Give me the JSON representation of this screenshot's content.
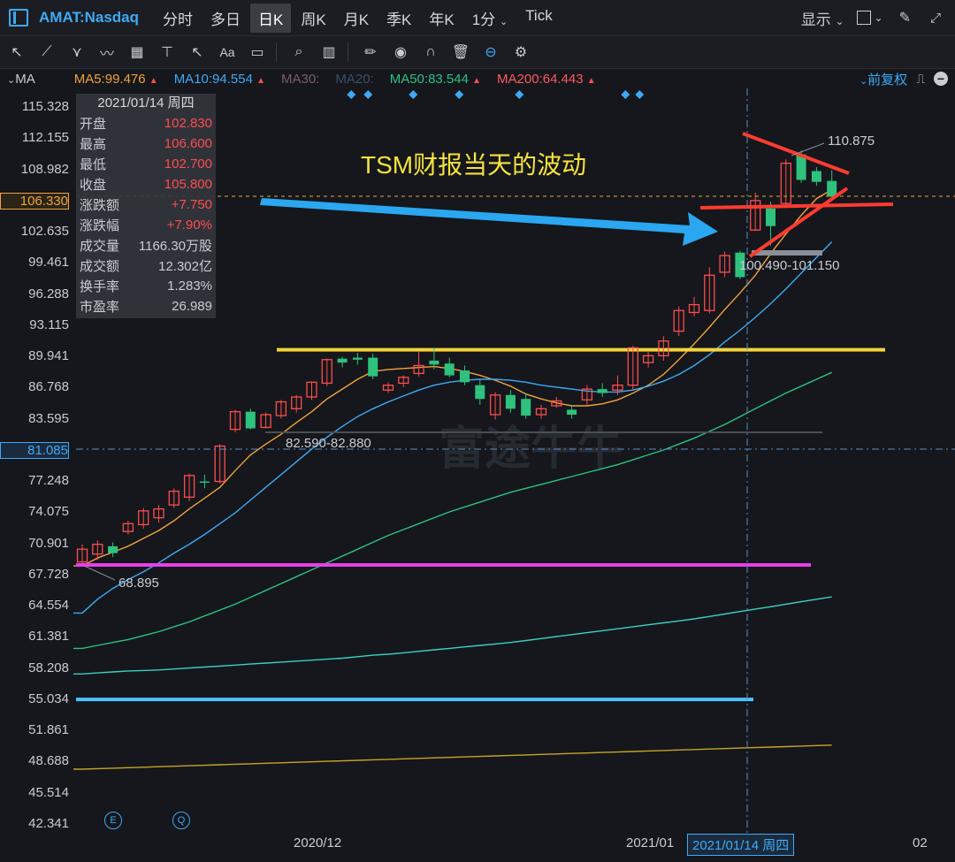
{
  "header": {
    "symbol": "AMAT:Nasdaq",
    "tabs": [
      "分时",
      "多日",
      "日K",
      "周K",
      "月K",
      "季K",
      "年K",
      "1分",
      "Tick"
    ],
    "active_tab": "日K",
    "display_label": "显示"
  },
  "ma_bar": {
    "ma_label": "MA",
    "items": [
      {
        "text": "MA5:99.476",
        "color": "#f0a23c",
        "arrow": "▲"
      },
      {
        "text": "MA10:94.554",
        "color": "#3fa9f5",
        "arrow": "▲"
      },
      {
        "text": "MA30:",
        "color": "#7a5d6e",
        "arrow": ""
      },
      {
        "text": "MA20:",
        "color": "#3b4f6b",
        "arrow": ""
      },
      {
        "text": "MA50:83.544",
        "color": "#2ec27e",
        "arrow": "▲"
      },
      {
        "text": "MA200:64.443",
        "color": "#ff5a5a",
        "arrow": "▲"
      }
    ],
    "adjust_label": "前复权"
  },
  "y_axis": {
    "ticks": [
      "115.328",
      "112.155",
      "108.982",
      "106.330",
      "102.635",
      "99.461",
      "96.288",
      "93.115",
      "89.941",
      "86.768",
      "83.595",
      "81.085",
      "77.248",
      "74.075",
      "70.901",
      "67.728",
      "64.554",
      "61.381",
      "58.208",
      "55.034",
      "51.861",
      "48.688",
      "45.514",
      "42.341"
    ],
    "highlight_price": "106.330",
    "highlight_crosshair": "81.085"
  },
  "info_panel": {
    "date": "2021/01/14 周四",
    "rows": [
      {
        "label": "开盘",
        "value": "102.830",
        "color": "#ff4d4d"
      },
      {
        "label": "最高",
        "value": "106.600",
        "color": "#ff4d4d"
      },
      {
        "label": "最低",
        "value": "102.700",
        "color": "#ff4d4d"
      },
      {
        "label": "收盘",
        "value": "105.800",
        "color": "#ff4d4d"
      },
      {
        "label": "涨跌额",
        "value": "+7.750",
        "color": "#ff4d4d"
      },
      {
        "label": "涨跌幅",
        "value": "+7.90%",
        "color": "#ff4d4d"
      },
      {
        "label": "成交量",
        "value": "1166.30万股",
        "color": "#c9ccd3"
      },
      {
        "label": "成交额",
        "value": "12.302亿",
        "color": "#c9ccd3"
      },
      {
        "label": "换手率",
        "value": "1.283%",
        "color": "#c9ccd3"
      },
      {
        "label": "市盈率",
        "value": "26.989",
        "color": "#c9ccd3"
      }
    ]
  },
  "annotations": {
    "headline": "TSM财报当天的波动",
    "high_label": "110.875",
    "gap_top": "100.490-101.150",
    "gap_mid": "82.590-82.880",
    "low_label": "68.895"
  },
  "x_axis": {
    "labels": [
      "2020/12",
      "2021/01",
      "02"
    ],
    "crosshair_date": "2021/01/14 周四"
  },
  "watermark": "富途牛牛",
  "colors": {
    "up": "#ff4d4d",
    "down": "#2ec27e",
    "accent": "#3fa9f5",
    "background": "#15171c"
  },
  "chart_data": {
    "type": "candlestick",
    "y_range": [
      42.341,
      115.328
    ],
    "candles": [
      {
        "o": 69.0,
        "h": 70.8,
        "l": 68.9,
        "c": 70.3
      },
      {
        "o": 69.8,
        "h": 71.2,
        "l": 69.2,
        "c": 70.8
      },
      {
        "o": 70.6,
        "h": 71.0,
        "l": 69.5,
        "c": 69.9
      },
      {
        "o": 72.1,
        "h": 73.2,
        "l": 71.8,
        "c": 72.9
      },
      {
        "o": 72.8,
        "h": 74.5,
        "l": 72.4,
        "c": 74.2
      },
      {
        "o": 73.5,
        "h": 74.8,
        "l": 73.0,
        "c": 74.4
      },
      {
        "o": 74.8,
        "h": 76.5,
        "l": 74.5,
        "c": 76.2
      },
      {
        "o": 75.6,
        "h": 78.0,
        "l": 75.2,
        "c": 77.8
      },
      {
        "o": 77.2,
        "h": 77.9,
        "l": 76.5,
        "c": 77.1
      },
      {
        "o": 77.2,
        "h": 81.0,
        "l": 77.0,
        "c": 80.8
      },
      {
        "o": 82.5,
        "h": 84.5,
        "l": 82.2,
        "c": 84.3
      },
      {
        "o": 84.3,
        "h": 84.6,
        "l": 82.5,
        "c": 82.6
      },
      {
        "o": 82.7,
        "h": 84.2,
        "l": 82.6,
        "c": 84.0
      },
      {
        "o": 83.9,
        "h": 85.5,
        "l": 83.6,
        "c": 85.3
      },
      {
        "o": 84.6,
        "h": 86.0,
        "l": 84.2,
        "c": 85.8
      },
      {
        "o": 85.8,
        "h": 87.4,
        "l": 85.5,
        "c": 87.3
      },
      {
        "o": 87.2,
        "h": 89.7,
        "l": 86.9,
        "c": 89.6
      },
      {
        "o": 89.7,
        "h": 89.9,
        "l": 88.8,
        "c": 89.3
      },
      {
        "o": 89.8,
        "h": 90.3,
        "l": 89.1,
        "c": 89.6
      },
      {
        "o": 89.8,
        "h": 90.2,
        "l": 87.6,
        "c": 87.9
      },
      {
        "o": 86.5,
        "h": 87.3,
        "l": 86.2,
        "c": 87.0
      },
      {
        "o": 87.2,
        "h": 88.0,
        "l": 86.8,
        "c": 87.8
      },
      {
        "o": 88.2,
        "h": 90.4,
        "l": 87.9,
        "c": 89.0
      },
      {
        "o": 89.5,
        "h": 90.8,
        "l": 88.6,
        "c": 89.1
      },
      {
        "o": 89.2,
        "h": 89.8,
        "l": 87.8,
        "c": 88.0
      },
      {
        "o": 88.5,
        "h": 89.0,
        "l": 87.0,
        "c": 87.3
      },
      {
        "o": 87.0,
        "h": 87.6,
        "l": 85.0,
        "c": 85.6
      },
      {
        "o": 84.0,
        "h": 86.3,
        "l": 83.5,
        "c": 86.0
      },
      {
        "o": 86.0,
        "h": 86.5,
        "l": 84.2,
        "c": 84.6
      },
      {
        "o": 85.6,
        "h": 86.2,
        "l": 83.6,
        "c": 83.9
      },
      {
        "o": 84.0,
        "h": 85.0,
        "l": 83.6,
        "c": 84.6
      },
      {
        "o": 84.9,
        "h": 85.8,
        "l": 84.7,
        "c": 85.4
      },
      {
        "o": 84.5,
        "h": 85.0,
        "l": 83.6,
        "c": 84.0
      },
      {
        "o": 85.5,
        "h": 87.0,
        "l": 85.0,
        "c": 86.6
      },
      {
        "o": 86.6,
        "h": 87.2,
        "l": 85.8,
        "c": 86.2
      },
      {
        "o": 86.5,
        "h": 88.0,
        "l": 86.0,
        "c": 87.0
      },
      {
        "o": 87.0,
        "h": 91.0,
        "l": 86.5,
        "c": 90.8
      },
      {
        "o": 89.3,
        "h": 90.5,
        "l": 88.8,
        "c": 90.0
      },
      {
        "o": 90.0,
        "h": 92.0,
        "l": 89.5,
        "c": 91.5
      },
      {
        "o": 92.5,
        "h": 95.0,
        "l": 92.0,
        "c": 94.6
      },
      {
        "o": 94.4,
        "h": 96.0,
        "l": 94.0,
        "c": 95.2
      },
      {
        "o": 94.6,
        "h": 99.0,
        "l": 94.3,
        "c": 98.2
      },
      {
        "o": 98.5,
        "h": 100.6,
        "l": 98.0,
        "c": 100.2
      },
      {
        "o": 100.5,
        "h": 100.7,
        "l": 97.8,
        "c": 98.0
      },
      {
        "o": 102.8,
        "h": 106.6,
        "l": 102.7,
        "c": 105.8
      },
      {
        "o": 105.0,
        "h": 105.7,
        "l": 101.2,
        "c": 103.2
      },
      {
        "o": 105.5,
        "h": 110.0,
        "l": 105.2,
        "c": 109.6
      },
      {
        "o": 110.5,
        "h": 110.9,
        "l": 107.6,
        "c": 107.9
      },
      {
        "o": 108.8,
        "h": 109.2,
        "l": 107.3,
        "c": 107.7
      },
      {
        "o": 107.8,
        "h": 108.9,
        "l": 105.9,
        "c": 106.2
      }
    ],
    "ma_lines": [
      {
        "name": "MA5",
        "color": "#f0a23c",
        "values": [
          68.6,
          69.4,
          70.0,
          70.6,
          71.4,
          72.2,
          73.2,
          74.4,
          75.5,
          76.6,
          78.3,
          79.9,
          81.0,
          82.0,
          83.2,
          84.3,
          85.6,
          86.6,
          87.6,
          88.4,
          88.6,
          88.7,
          88.8,
          88.9,
          88.7,
          88.4,
          88.0,
          87.5,
          86.9,
          86.1,
          85.6,
          85.2,
          84.9,
          84.9,
          85.1,
          85.5,
          86.2,
          87.0,
          88.1,
          89.6,
          91.2,
          92.9,
          94.7,
          96.4,
          98.2,
          100.4,
          102.4,
          104.3,
          106.0,
          106.9
        ]
      },
      {
        "name": "MA10",
        "color": "#3fa9f5",
        "values": [
          63.8,
          65.2,
          66.3,
          67.2,
          68.0,
          68.9,
          69.9,
          70.8,
          71.8,
          72.9,
          74.0,
          75.3,
          76.6,
          77.9,
          79.2,
          80.5,
          81.7,
          82.8,
          83.8,
          84.6,
          85.3,
          85.9,
          86.5,
          87.0,
          87.3,
          87.5,
          87.6,
          87.6,
          87.5,
          87.3,
          87.0,
          86.8,
          86.6,
          86.4,
          86.3,
          86.3,
          86.5,
          86.9,
          87.4,
          88.1,
          89.0,
          90.1,
          91.4,
          92.6,
          93.9,
          95.3,
          96.8,
          98.4,
          100.0,
          101.6
        ]
      },
      {
        "name": "MA50",
        "color": "#2ec27e",
        "values": [
          60.2,
          60.5,
          60.8,
          61.1,
          61.5,
          61.9,
          62.4,
          62.9,
          63.5,
          64.1,
          64.7,
          65.4,
          66.1,
          66.8,
          67.5,
          68.2,
          68.9,
          69.6,
          70.3,
          71.0,
          71.7,
          72.3,
          72.9,
          73.5,
          74.1,
          74.6,
          75.1,
          75.6,
          76.1,
          76.5,
          76.9,
          77.3,
          77.7,
          78.1,
          78.5,
          78.9,
          79.4,
          79.9,
          80.4,
          81.0,
          81.6,
          82.3,
          83.0,
          83.8,
          84.6,
          85.4,
          86.2,
          86.9,
          87.6,
          88.3
        ]
      },
      {
        "name": "MA200",
        "color": "#3ecfc0",
        "values": [
          57.6,
          57.7,
          57.8,
          57.9,
          57.95,
          58.0,
          58.1,
          58.2,
          58.3,
          58.4,
          58.5,
          58.6,
          58.7,
          58.8,
          58.9,
          59.0,
          59.1,
          59.2,
          59.35,
          59.5,
          59.6,
          59.75,
          59.9,
          60.05,
          60.2,
          60.35,
          60.5,
          60.65,
          60.8,
          61.0,
          61.2,
          61.4,
          61.6,
          61.8,
          62.0,
          62.2,
          62.4,
          62.6,
          62.8,
          63.0,
          63.2,
          63.45,
          63.7,
          63.95,
          64.2,
          64.44,
          64.7,
          64.95,
          65.2,
          65.45
        ]
      },
      {
        "name": "MA-long",
        "color": "#c9a227",
        "values": [
          47.9,
          47.95,
          48.0,
          48.05,
          48.1,
          48.15,
          48.2,
          48.25,
          48.3,
          48.35,
          48.4,
          48.45,
          48.5,
          48.55,
          48.6,
          48.65,
          48.7,
          48.75,
          48.8,
          48.85,
          48.9,
          48.95,
          49.0,
          49.05,
          49.1,
          49.15,
          49.2,
          49.25,
          49.3,
          49.35,
          49.4,
          49.45,
          49.5,
          49.55,
          49.6,
          49.65,
          49.7,
          49.75,
          49.8,
          49.85,
          49.9,
          49.95,
          50.0,
          50.05,
          50.1,
          50.15,
          50.2,
          50.25,
          50.3,
          50.35
        ]
      }
    ],
    "drawn_lines": [
      {
        "name": "resistance",
        "color": "#f5d33d",
        "y": 90.6
      },
      {
        "name": "support-low",
        "color": "#e83ee8",
        "y": 68.7
      },
      {
        "name": "support-deep",
        "color": "#4cc3ff",
        "y": 55.0
      }
    ]
  }
}
